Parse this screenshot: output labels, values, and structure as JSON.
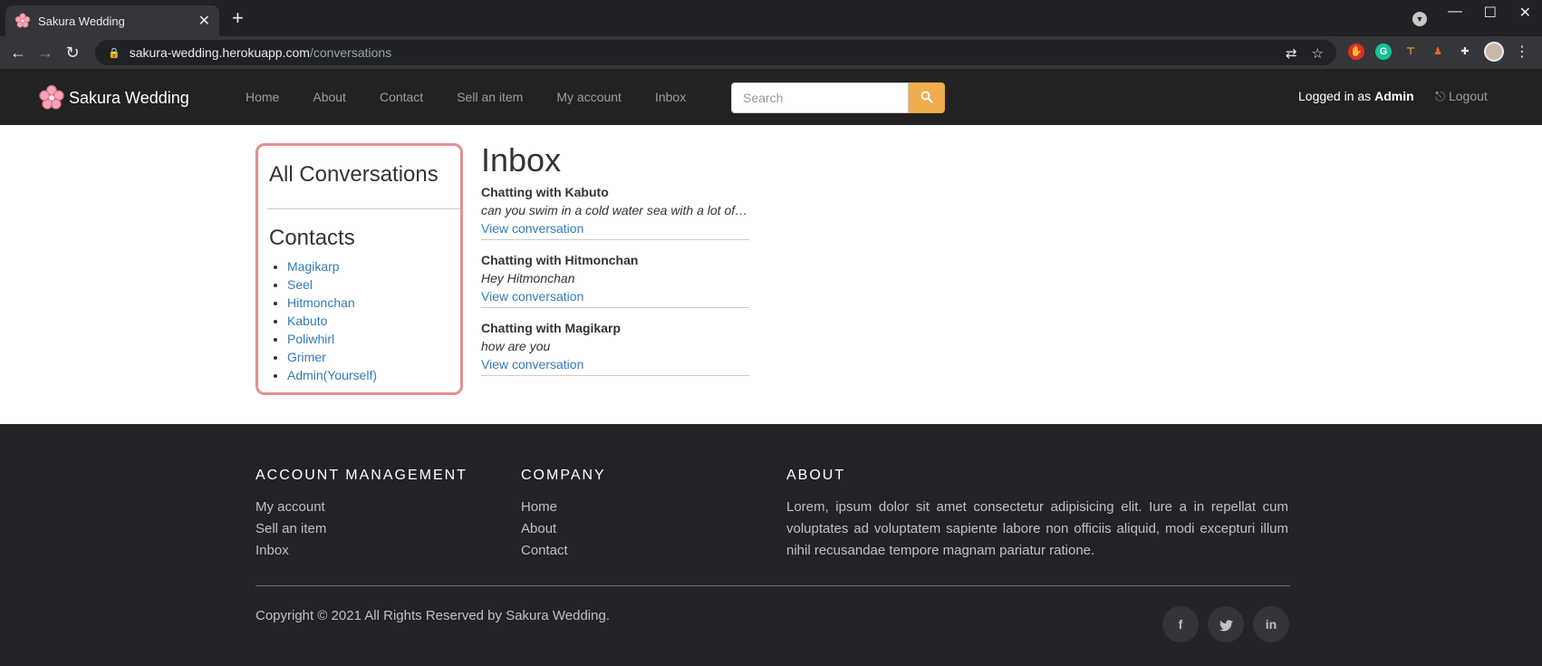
{
  "browser": {
    "tab_title": "Sakura Wedding",
    "url_host": "sakura-wedding.herokuapp.com",
    "url_path": "/conversations"
  },
  "navbar": {
    "brand": "Sakura Wedding",
    "links": [
      "Home",
      "About",
      "Contact",
      "Sell an item",
      "My account",
      "Inbox"
    ],
    "search_placeholder": "Search",
    "logged_in_prefix": "Logged in as",
    "username": "Admin",
    "logout": "Logout"
  },
  "sidebar": {
    "heading": "All Conversations",
    "contacts_heading": "Contacts",
    "contacts": [
      "Magikarp",
      "Seel",
      "Hitmonchan",
      "Kabuto",
      "Poliwhirl",
      "Grimer",
      "Admin(Yourself)"
    ]
  },
  "inbox": {
    "title": "Inbox",
    "conversations": [
      {
        "with": "Chatting with Kabuto",
        "preview": "can you swim in a cold water sea with a lot of fish?",
        "link": "View conversation"
      },
      {
        "with": "Chatting with Hitmonchan",
        "preview": "Hey Hitmonchan",
        "link": "View conversation"
      },
      {
        "with": "Chatting with Magikarp",
        "preview": "how are you",
        "link": "View conversation"
      }
    ]
  },
  "footer": {
    "account_heading": "ACCOUNT MANAGEMENT",
    "account_links": [
      "My account",
      "Sell an item",
      "Inbox"
    ],
    "company_heading": "COMPANY",
    "company_links": [
      "Home",
      "About",
      "Contact"
    ],
    "about_heading": "ABOUT",
    "about_text": "Lorem, ipsum dolor sit amet consectetur adipisicing elit. Iure a in repellat cum voluptates ad voluptatem sapiente labore non officiis aliquid, modi excepturi illum nihil recusandae tempore magnam pariatur ratione.",
    "copyright": "Copyright © 2021 All Rights Reserved by Sakura Wedding.",
    "social_icons": [
      "facebook-icon",
      "twitter-icon",
      "linkedin-icon"
    ]
  },
  "colors": {
    "navbar_bg": "#222222",
    "footer_bg": "#222327",
    "link": "#337ab7",
    "search_button": "#f0ad4e",
    "sidebar_border": "#e48f92"
  }
}
